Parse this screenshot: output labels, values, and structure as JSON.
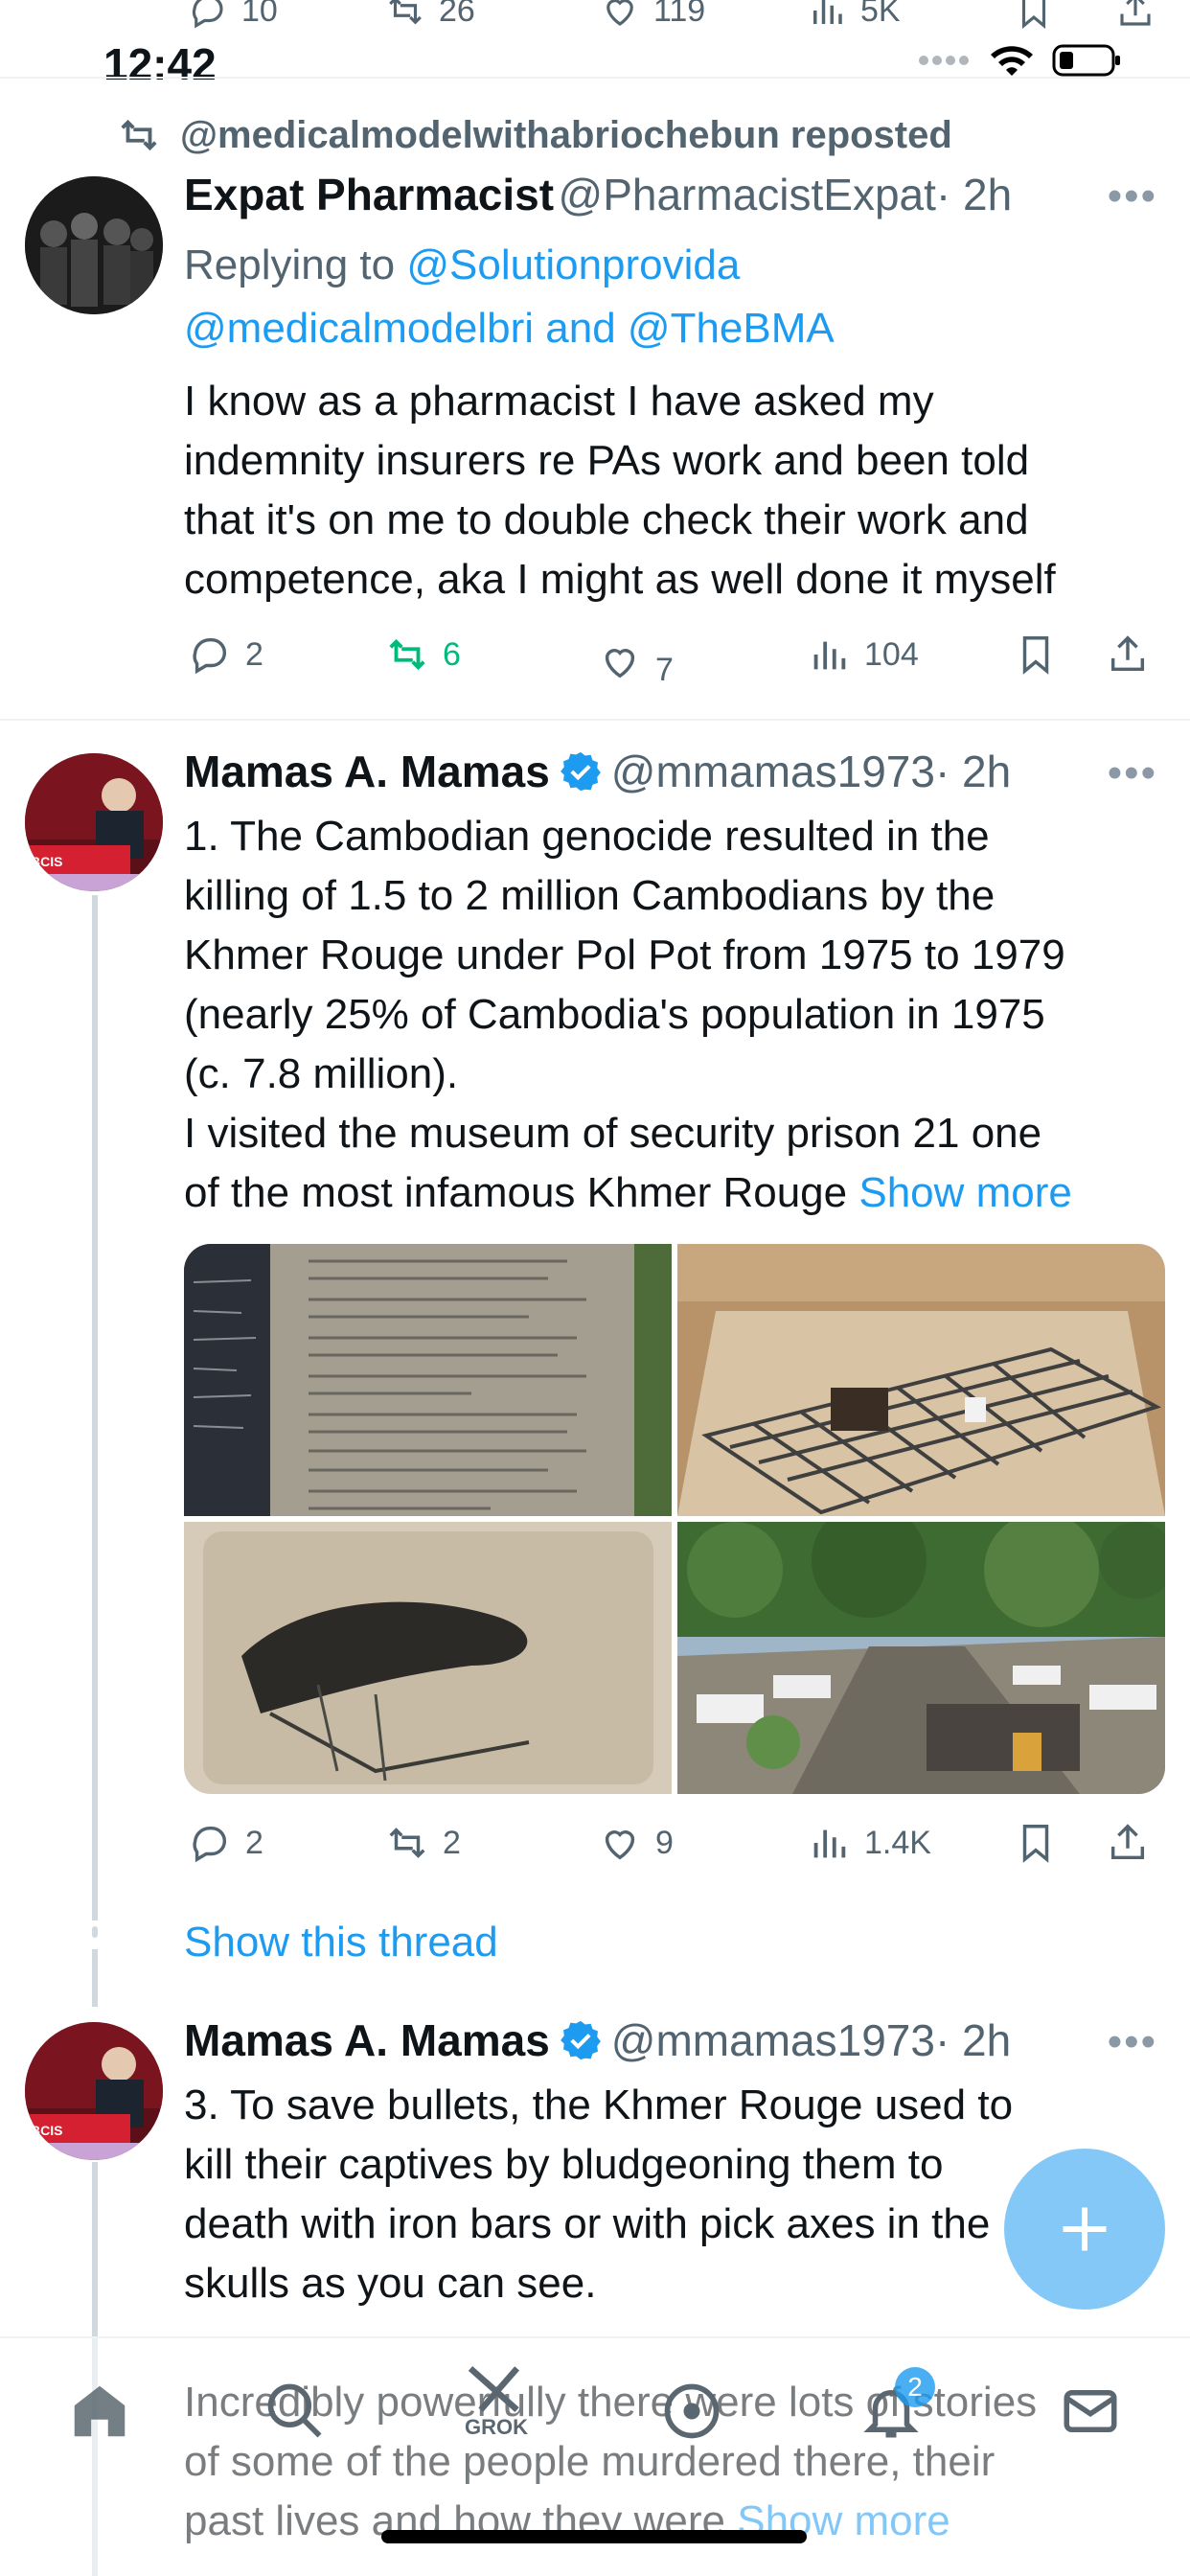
{
  "status_bar": {
    "time": "12:42"
  },
  "top_partial_actions": {
    "replies": "10",
    "reposts": "26",
    "likes": "119",
    "views": "5K"
  },
  "tweets": [
    {
      "repost_banner": "@medicalmodelwithabriochebun reposted",
      "display_name": "Expat Pharmacist",
      "handle": "@PharmacistExpat",
      "time": "· 2h",
      "replying_prefix": "Replying to",
      "replying_to_1": "@Solutionprovida",
      "replying_to_2": "@medicalmodelbri",
      "replying_and": "and",
      "replying_to_3": "@TheBMA",
      "text": [
        "I know as a pharmacist I have asked my",
        "indemnity insurers re PAs work and been told",
        "that it's on me to double check their work and",
        "competence, aka I might as well done it myself"
      ],
      "replies": "2",
      "reposts": "6",
      "likes": "7",
      "views": "104"
    },
    {
      "display_name": "Mamas A. Mamas",
      "handle": "@mmamas1973",
      "time": "· 2h",
      "text": [
        "1. The Cambodian genocide resulted in the",
        "killing of 1.5 to 2 million Cambodians by the",
        "Khmer Rouge under Pol Pot from 1975 to 1979",
        "(nearly 25% of Cambodia's population in 1975",
        "(c. 7.8 million).",
        "I visited the museum of security prison 21 one",
        "of the most infamous Khmer Rouge"
      ],
      "show_more": "Show more",
      "replies": "2",
      "reposts": "2",
      "likes": "9",
      "views": "1.4K",
      "show_thread": "Show this thread"
    },
    {
      "display_name": "Mamas A. Mamas",
      "handle": "@mmamas1973",
      "time": "· 2h",
      "text": [
        "3. To save bullets, the Khmer  Rouge used to",
        "kill their captives by bludgeoning them to",
        "death with iron bars or with pick axes in the",
        "skulls as you can see."
      ],
      "text_faded": [
        "Incredibly powerfully there were lots of stories",
        "of some of the people murdered there, their",
        "past lives and how they were"
      ],
      "show_more": "Show more"
    }
  ],
  "nav": {
    "notifications_badge": "2",
    "grok_label": "GROK"
  },
  "colors": {
    "accent": "#1d9bf0",
    "repost_green": "#00ba7c",
    "secondary_text": "#536471"
  }
}
